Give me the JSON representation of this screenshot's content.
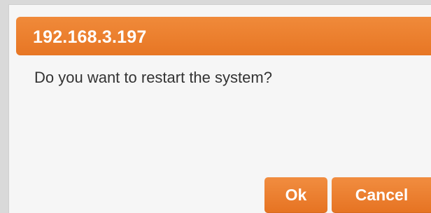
{
  "dialog": {
    "title": "192.168.3.197",
    "message": "Do you want to restart the system?",
    "buttons": {
      "ok_label": "Ok",
      "cancel_label": "Cancel"
    },
    "colors": {
      "accent": "#e97a28",
      "background": "#f6f6f6",
      "text": "#333333",
      "button_text": "#ffffff"
    }
  }
}
